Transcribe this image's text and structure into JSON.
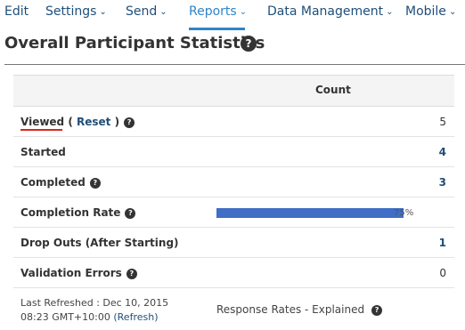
{
  "nav": {
    "items": [
      {
        "label": "Edit",
        "chevron": false
      },
      {
        "label": "Settings",
        "chevron": true
      },
      {
        "label": "Send",
        "chevron": true
      },
      {
        "label": "Reports",
        "chevron": true,
        "active": true
      },
      {
        "label": "Data Management",
        "chevron": true
      },
      {
        "label": "Mobile",
        "chevron": true
      }
    ],
    "chevron_glyph": "⌄"
  },
  "page": {
    "title": "Overall Participant Statistics",
    "help_glyph": "?"
  },
  "table": {
    "header_count": "Count",
    "rows": [
      {
        "label": "Viewed",
        "reset_open": " ( ",
        "reset_label": "Reset",
        "reset_close": " )",
        "value": "5"
      },
      {
        "label": "Started",
        "value": "4"
      },
      {
        "label": "Completed",
        "value": "3"
      },
      {
        "label": "Completion Rate",
        "bar_percent": 75,
        "percent_text": "75%"
      },
      {
        "label": "Drop Outs (After Starting)",
        "value": "1"
      },
      {
        "label": "Validation Errors",
        "value": "0"
      }
    ]
  },
  "footer": {
    "refreshed_prefix": "Last Refreshed : Dec 10, 2015 08:23 GMT+10:00 ",
    "refresh_label": "(Refresh)",
    "response_rates_label": "Response Rates - Explained"
  },
  "colors": {
    "nav_text": "#1f4e79",
    "nav_active": "#2e84c8",
    "bar": "#3f6ec6",
    "highlight_underline": "#d9261c"
  }
}
